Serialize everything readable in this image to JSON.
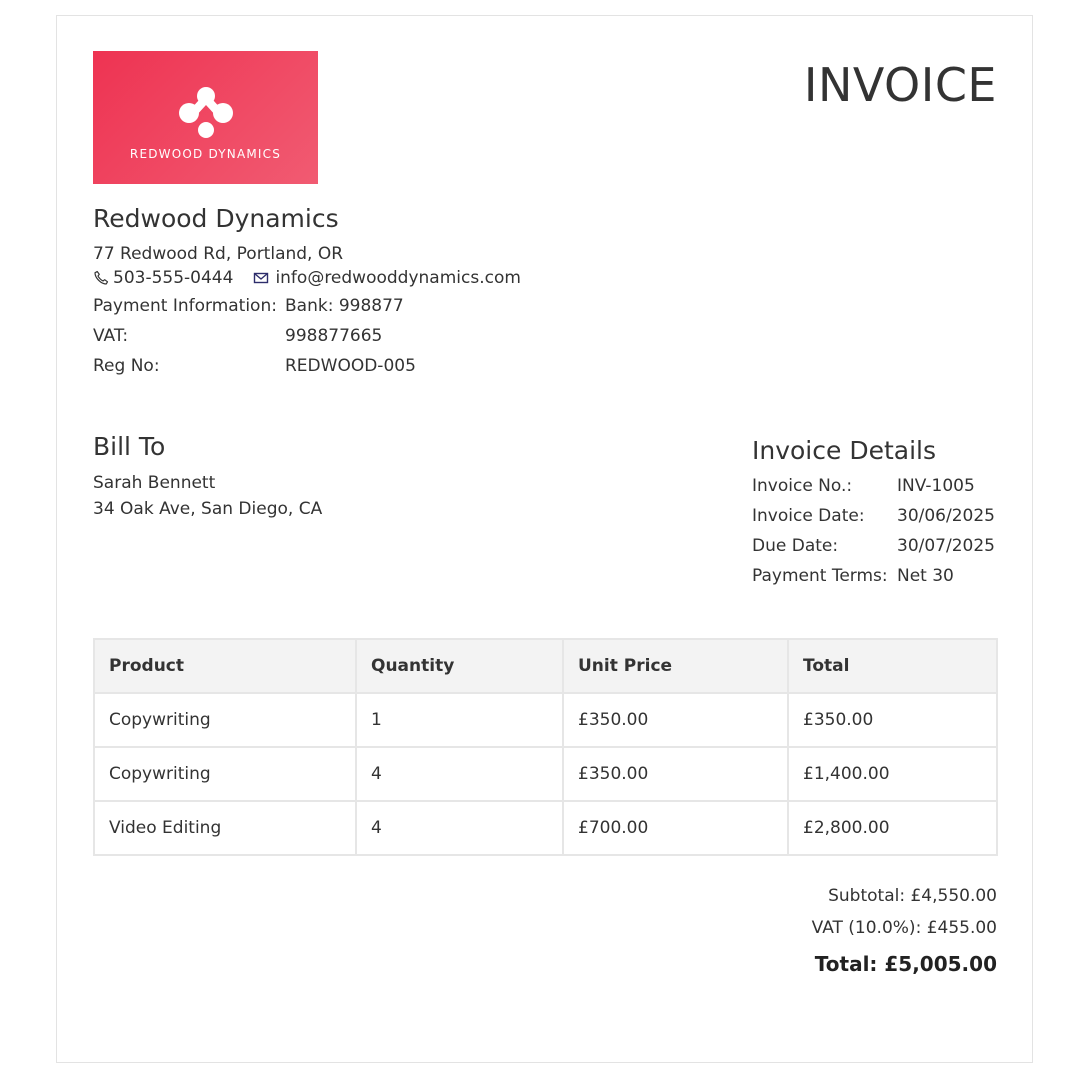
{
  "header": {
    "title": "INVOICE",
    "logo_text": "REDWOOD DYNAMICS"
  },
  "company": {
    "name": "Redwood Dynamics",
    "address": "77 Redwood Rd, Portland, OR",
    "phone": "503-555-0444",
    "email": "info@redwooddynamics.com",
    "info": [
      {
        "label": "Payment Information:",
        "value": "Bank: 998877"
      },
      {
        "label": "VAT:",
        "value": "998877665"
      },
      {
        "label": "Reg No:",
        "value": "REDWOOD-005"
      }
    ]
  },
  "bill_to": {
    "heading": "Bill To",
    "name": "Sarah Bennett",
    "address": "34 Oak Ave, San Diego, CA"
  },
  "details": {
    "heading": "Invoice Details",
    "rows": [
      {
        "label": "Invoice No.:",
        "value": "INV-1005"
      },
      {
        "label": "Invoice Date:",
        "value": "30/06/2025"
      },
      {
        "label": "Due Date:",
        "value": "30/07/2025"
      },
      {
        "label": "Payment Terms:",
        "value": "Net 30"
      }
    ]
  },
  "items": {
    "headers": [
      "Product",
      "Quantity",
      "Unit Price",
      "Total"
    ],
    "rows": [
      [
        "Copywriting",
        "1",
        "£350.00",
        "£350.00"
      ],
      [
        "Copywriting",
        "4",
        "£350.00",
        "£1,400.00"
      ],
      [
        "Video Editing",
        "4",
        "£700.00",
        "£2,800.00"
      ]
    ]
  },
  "totals": {
    "subtotal": "Subtotal: £4,550.00",
    "vat": "VAT (10.0%): £455.00",
    "total": "Total: £5,005.00"
  },
  "icons": {
    "logo": "redwood-logo-mark",
    "phone": "phone-icon",
    "email": "envelope-icon"
  },
  "colors": {
    "brand": "#ee3352",
    "brand_light": "#f15b72",
    "header_bg": "#f3f3f3"
  }
}
